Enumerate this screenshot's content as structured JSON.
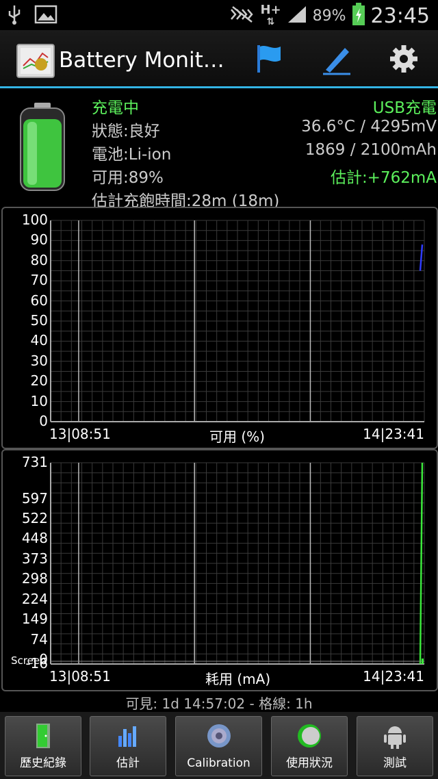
{
  "status_bar": {
    "battery_percent": "89%",
    "network": "H+",
    "time": "23:45",
    "icons": [
      "usb-icon",
      "image-icon",
      "silent-icon",
      "network-h-plus-icon",
      "signal-icon",
      "battery-charging-icon"
    ]
  },
  "action_bar": {
    "title": "Battery Monit…",
    "actions": [
      "flag-icon",
      "edit-icon",
      "settings-icon"
    ]
  },
  "info": {
    "charging": "充電中",
    "charge_source": "USB充電",
    "status": "狀態:良好",
    "temp_voltage": "36.6°C / 4295mV",
    "battery_type": "電池:Li-ion",
    "capacity": "1869 / 2100mAh",
    "available": "可用:89%",
    "estimate": "估計:+762mA",
    "full_time": "估計充飽時間:28m (18m)"
  },
  "chart_top": {
    "yticks": [
      "100",
      "90",
      "80",
      "70",
      "60",
      "50",
      "40",
      "30",
      "20",
      "10",
      "0"
    ],
    "x_start": "13|08:51",
    "x_label": "可用 (%)",
    "x_end": "14|23:41"
  },
  "chart_bottom": {
    "yticks": [
      "731",
      "597",
      "522",
      "448",
      "373",
      "298",
      "224",
      "149",
      "74",
      "0",
      "-16"
    ],
    "screen_label": "Screen",
    "x_start": "13|08:51",
    "x_label": "耗用 (mA)",
    "x_end": "14|23:41"
  },
  "chart_data": [
    {
      "type": "line",
      "xlabel": "可用 (%)",
      "x_ticks": [
        "13|08:51",
        "14|23:41"
      ],
      "ylim": [
        0,
        100
      ],
      "y_ticks": [
        0,
        10,
        20,
        30,
        40,
        50,
        60,
        70,
        80,
        90,
        100
      ],
      "grid": true,
      "series": [
        {
          "color": "#2f3cff",
          "values": [
            75,
            88
          ]
        }
      ]
    },
    {
      "type": "line",
      "xlabel": "耗用 (mA)",
      "x_ticks": [
        "13|08:51",
        "14|23:41"
      ],
      "ylim": [
        -16,
        731
      ],
      "y_ticks": [
        -16,
        0,
        74,
        149,
        224,
        298,
        373,
        448,
        522,
        597,
        731
      ],
      "grid": true,
      "series": [
        {
          "color": "#3ce83c",
          "values": [
            -16,
            731
          ]
        }
      ]
    }
  ],
  "footer": {
    "visible_range": "可見: 1d 14:57:02 - 格線: 1h"
  },
  "bottom_buttons": [
    {
      "label": "歷史紀錄"
    },
    {
      "label": "估計"
    },
    {
      "label": "Calibration"
    },
    {
      "label": "使用狀況"
    },
    {
      "label": "測試"
    }
  ],
  "colors": {
    "accent": "#33b5e5",
    "green_text": "#5cf05c"
  }
}
